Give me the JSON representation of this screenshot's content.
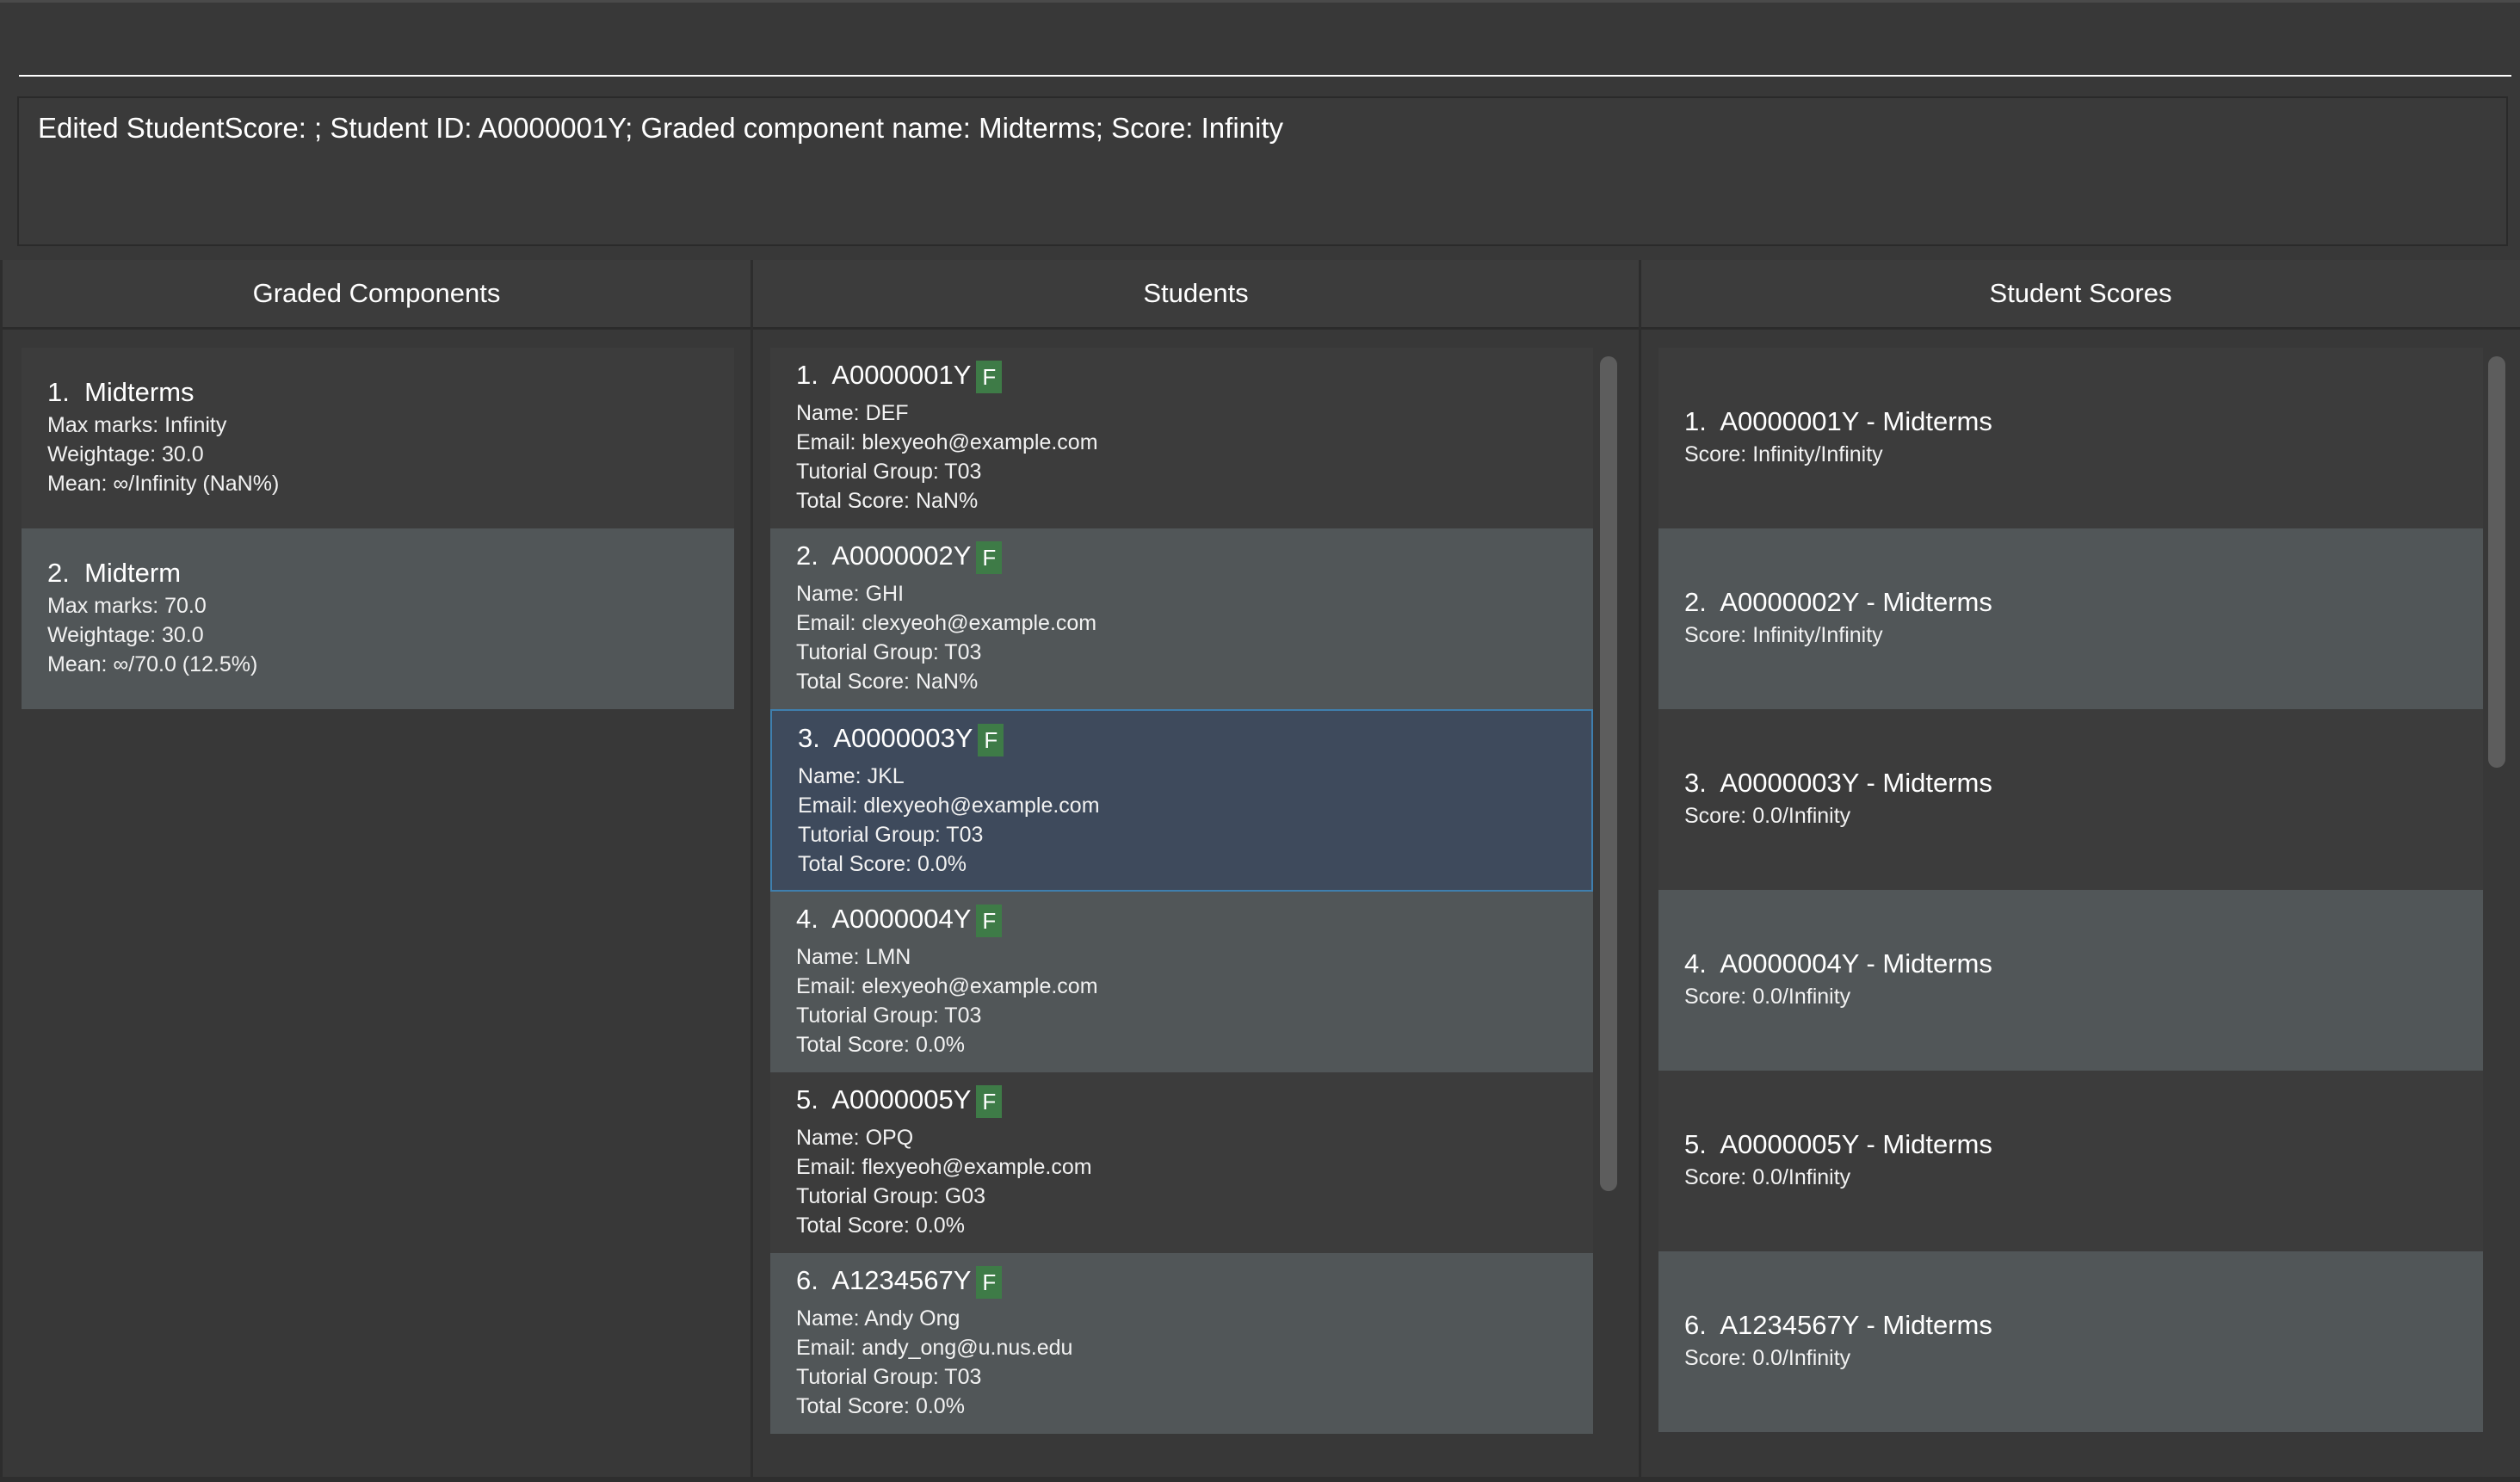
{
  "command": {
    "value": "",
    "result": "Edited StudentScore: ; Student ID: A0000001Y; Graded component name: Midterms; Score: Infinity"
  },
  "components_panel": {
    "header": "Graded Components",
    "items": [
      {
        "index": "1.",
        "name": "Midterms",
        "max_marks": "Max marks: Infinity",
        "weightage": "Weightage: 30.0",
        "mean": "Mean: ∞/Infinity (NaN%)"
      },
      {
        "index": "2.",
        "name": "Midterm",
        "max_marks": "Max marks: 70.0",
        "weightage": "Weightage: 30.0",
        "mean": "Mean: ∞/70.0 (12.5%)"
      }
    ]
  },
  "students_panel": {
    "header": "Students",
    "items": [
      {
        "index": "1.",
        "id": "A0000001Y",
        "tag": "F",
        "name": "Name: DEF",
        "email": "Email: blexyeoh@example.com",
        "tutorial": "Tutorial Group: T03",
        "total": "Total Score: NaN%"
      },
      {
        "index": "2.",
        "id": "A0000002Y",
        "tag": "F",
        "name": "Name: GHI",
        "email": "Email: clexyeoh@example.com",
        "tutorial": "Tutorial Group: T03",
        "total": "Total Score: NaN%"
      },
      {
        "index": "3.",
        "id": "A0000003Y",
        "tag": "F",
        "name": "Name: JKL",
        "email": "Email: dlexyeoh@example.com",
        "tutorial": "Tutorial Group: T03",
        "total": "Total Score: 0.0%"
      },
      {
        "index": "4.",
        "id": "A0000004Y",
        "tag": "F",
        "name": "Name: LMN",
        "email": "Email: elexyeoh@example.com",
        "tutorial": "Tutorial Group: T03",
        "total": "Total Score: 0.0%"
      },
      {
        "index": "5.",
        "id": "A0000005Y",
        "tag": "F",
        "name": "Name: OPQ",
        "email": "Email: flexyeoh@example.com",
        "tutorial": "Tutorial Group: G03",
        "total": "Total Score: 0.0%"
      },
      {
        "index": "6.",
        "id": "A1234567Y",
        "tag": "F",
        "name": "Name: Andy Ong",
        "email": "Email: andy_ong@u.nus.edu",
        "tutorial": "Tutorial Group: T03",
        "total": "Total Score: 0.0%"
      }
    ]
  },
  "scores_panel": {
    "header": "Student Scores",
    "items": [
      {
        "index": "1.",
        "title": "A0000001Y - Midterms",
        "score": "Score: Infinity/Infinity"
      },
      {
        "index": "2.",
        "title": "A0000002Y - Midterms",
        "score": "Score: Infinity/Infinity"
      },
      {
        "index": "3.",
        "title": "A0000003Y - Midterms",
        "score": "Score: 0.0/Infinity"
      },
      {
        "index": "4.",
        "title": "A0000004Y - Midterms",
        "score": "Score: 0.0/Infinity"
      },
      {
        "index": "5.",
        "title": "A0000005Y - Midterms",
        "score": "Score: 0.0/Infinity"
      },
      {
        "index": "6.",
        "title": "A1234567Y - Midterms",
        "score": "Score: 0.0/Infinity"
      }
    ]
  },
  "colors": {
    "background": "#383838",
    "card_dark": "#3c3c3c",
    "card_light": "#515658",
    "card_selected": "#3e4a5c",
    "selection_border": "#3f7fae",
    "tag": "#3e7b47"
  }
}
